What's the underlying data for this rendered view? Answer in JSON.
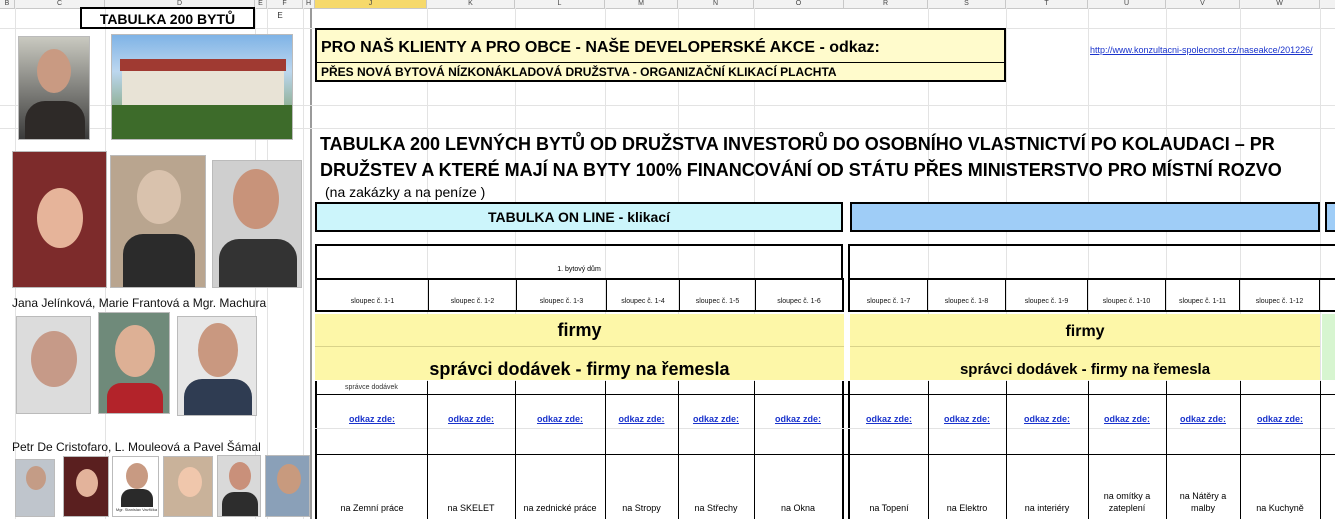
{
  "column_headers": [
    "B",
    "C",
    "D",
    "E",
    "F",
    "H",
    "J",
    "K",
    "L",
    "M",
    "N",
    "O",
    "R",
    "S",
    "T",
    "U",
    "V",
    "W"
  ],
  "title_cell": "TABULKA 200 BYTŮ",
  "column_e_label": "E",
  "promo": {
    "line1": "PRO NAŠ KLIENTY A PRO OBCE - NAŠE DEVELOPERSKÉ AKCE - odkaz:",
    "line2": "PŘES NOVÁ BYTOVÁ NÍZKONÁKLADOVÁ DRUŽSTVA - ORGANIZAČNÍ KLIKACÍ PLACHTA",
    "url": "http://www.konzultacni-spolecnost.cz/naseakce/201226/"
  },
  "headline": {
    "line1": "TABULKA 200 LEVNÝCH BYTŮ OD DRUŽSTVA INVESTORŮ DO OSOBNÍHO VLASTNICTVÍ PO KOLAUDACI – PR",
    "line2": "DRUŽSTEV A KTERÉ MAJÍ NA BYTY 100% FINANCOVÁNÍ OD STÁTU PŘES MINISTERSTVO PRO MÍSTNÍ ROZVO",
    "note": "(na zakázky a na peníze )"
  },
  "online_table_label": "TABULKA ON LINE - klikací",
  "house_label": "1. bytový dům",
  "captions": {
    "group1": "Jana Jelínková, Marie Frantová a Mgr. Machura",
    "group2": "Petr De Cristofaro, L. Mouleová a Pavel Šámal",
    "photo_sign": "Mgr. Stanislav Vavřička"
  },
  "firms_label": "firmy",
  "managers_label": "správci dodávek - firmy na řemesla",
  "managers_small": "správce dodávek",
  "columns": [
    {
      "col": "sloupec č. 1-1",
      "link": "odkaz zde:",
      "trade": "na Zemní práce"
    },
    {
      "col": "sloupec č. 1-2",
      "link": "odkaz zde:",
      "trade": "na SKELET"
    },
    {
      "col": "sloupec č. 1-3",
      "link": "odkaz zde:",
      "trade": "na zednické práce"
    },
    {
      "col": "sloupec č. 1-4",
      "link": "odkaz zde:",
      "trade": "na Stropy"
    },
    {
      "col": "sloupec č. 1-5",
      "link": "odkaz zde:",
      "trade": "na Střechy"
    },
    {
      "col": "sloupec č. 1-6",
      "link": "odkaz zde:",
      "trade": "na Okna"
    },
    {
      "col": "sloupec č. 1-7",
      "link": "odkaz zde:",
      "trade": "na Topení"
    },
    {
      "col": "sloupec č. 1-8",
      "link": "odkaz zde:",
      "trade": "na Elektro"
    },
    {
      "col": "sloupec č. 1-9",
      "link": "odkaz zde:",
      "trade": "na interiéry"
    },
    {
      "col": "sloupec č. 1-10",
      "link": "odkaz zde:",
      "trade": "na omítky a zateplení"
    },
    {
      "col": "sloupec č. 1-11",
      "link": "odkaz zde:",
      "trade": "na Nátěry a malby"
    },
    {
      "col": "sloupec č. 1-12",
      "link": "odkaz zde:",
      "trade": "na Kuchyně"
    }
  ],
  "colors": {
    "yellow": "#fffbcc",
    "cyan": "#ccf5fb",
    "blue": "#9fcdf7",
    "green": "#d7f5d0",
    "link": "#1a33cc"
  }
}
